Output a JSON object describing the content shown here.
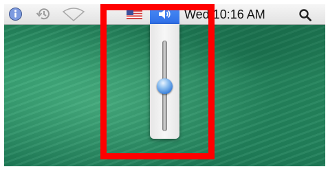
{
  "menubar": {
    "clock": "Wed 10:16 AM",
    "icons": [
      "info-icon",
      "time-machine-icon",
      "wifi-icon",
      "us-flag-icon",
      "volume-icon",
      "spotlight-search-icon"
    ]
  },
  "volume": {
    "level": 0.5
  },
  "colors": {
    "highlight": "#ff0000",
    "menu_selected": "#3a7cf0",
    "desktop": "#2a8c62"
  }
}
